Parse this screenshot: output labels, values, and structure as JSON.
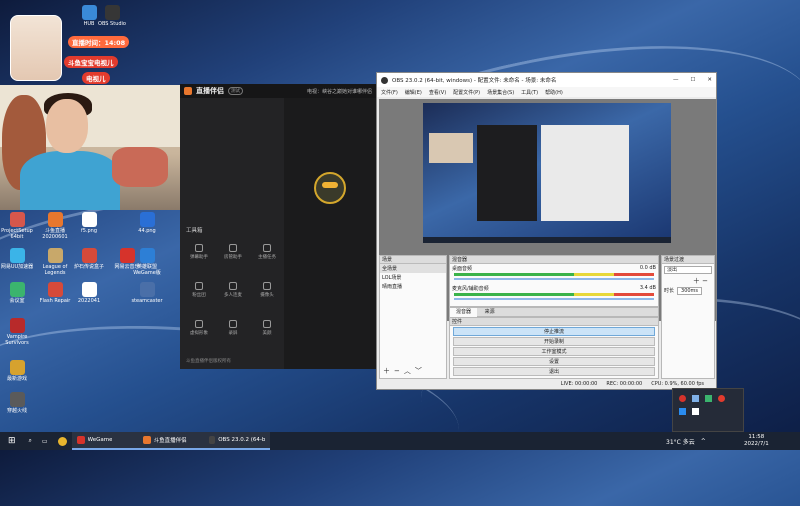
{
  "overlay": {
    "timer_label": "直播时间：14:08",
    "badge1": "斗鱼宝宝电视儿",
    "badge2": "电视儿"
  },
  "desktop_icons": [
    {
      "label": "HUB",
      "color": "#3a8ad8"
    },
    {
      "label": "OBS Studio",
      "color": "#363636"
    },
    {
      "label": "ProjectSetup 64bit",
      "color": "#d6574c"
    },
    {
      "label": "斗鱼直播 20200601",
      "color": "#e8772e"
    },
    {
      "label": "f5.png",
      "color": "#ffffff"
    },
    {
      "label": "44.png",
      "color": "#2a6fd6"
    },
    {
      "label": "网易UU加速器",
      "color": "#3bb4e8"
    },
    {
      "label": "League of Legends",
      "color": "#c8a86a"
    },
    {
      "label": "炉石传说盒子",
      "color": "#d64a3a"
    },
    {
      "label": "网易云音乐",
      "color": "#d6332b"
    },
    {
      "label": "英雄联盟WeGame版",
      "color": "#2d7fd6"
    },
    {
      "label": "会议室",
      "color": "#3bb46e"
    },
    {
      "label": "Flash Repair",
      "color": "#d64a3a"
    },
    {
      "label": "2022041",
      "color": "#ffffff"
    },
    {
      "label": "steamcaster",
      "color": "#4a6fa8"
    },
    {
      "label": "Vampire Survivors",
      "color": "#b82a2a"
    },
    {
      "label": "最新游戏",
      "color": "#d6a22e"
    },
    {
      "label": "穿越火线",
      "color": "#5a5a5a"
    }
  ],
  "douyu": {
    "logo": "直播伴侣",
    "version": "测试",
    "room_title": "电视：峡谷之巅她对谁哪伴侣",
    "tools_title": "工具箱",
    "footer": "斗鱼直播伴侣版权所有",
    "tools": [
      {
        "label": "弹幕助手"
      },
      {
        "label": "房管助手"
      },
      {
        "label": "主播任务"
      },
      {
        "label": "粉丝团"
      },
      {
        "label": "多人连麦"
      },
      {
        "label": "摄像头"
      },
      {
        "label": "虚拟形象"
      },
      {
        "label": "录屏"
      },
      {
        "label": "美颜"
      }
    ]
  },
  "obs": {
    "title": "OBS 23.0.2 (64-bit, windows) - 配置文件: 未命名 - 场景: 未命名",
    "menu": [
      "文件(F)",
      "编辑(E)",
      "查看(V)",
      "配置文件(P)",
      "场景集合(S)",
      "工具(T)",
      "帮助(H)"
    ],
    "scenes_title": "场景",
    "scenes": [
      "全场景",
      "LOL场景",
      "晴雨直播"
    ],
    "sources_title": "来源",
    "mixer_title": "混音器",
    "mixer": [
      {
        "name": "桌面音频",
        "db": "0.0 dB"
      },
      {
        "name": "麦克风/辅助音频",
        "db": "3.4 dB"
      }
    ],
    "transitions_title": "场景过渡",
    "transition": "淡出",
    "duration_label": "时长",
    "duration": "300ms",
    "controls_title": "控件",
    "controls": [
      "停止推流",
      "开始录制",
      "工作室模式",
      "设置",
      "退出"
    ],
    "status": {
      "live": "LIVE: 00:00:00",
      "rec": "REC: 00:00:00",
      "cpu": "CPU: 0.9%, 60.00 fps"
    }
  },
  "taskbar": {
    "items": [
      {
        "label": "WeGame",
        "color": "#d6332b"
      },
      {
        "label": "斗鱼直播伴侣",
        "color": "#e8772e"
      },
      {
        "label": "OBS 23.0.2 (64-bit...",
        "color": "#444444"
      }
    ],
    "weather": "31°C 多云",
    "clock_time": "11:58",
    "clock_date": "2022/7/1"
  },
  "colors": {
    "accent": "#e8772e",
    "obs_active": "#cbe3f7"
  }
}
